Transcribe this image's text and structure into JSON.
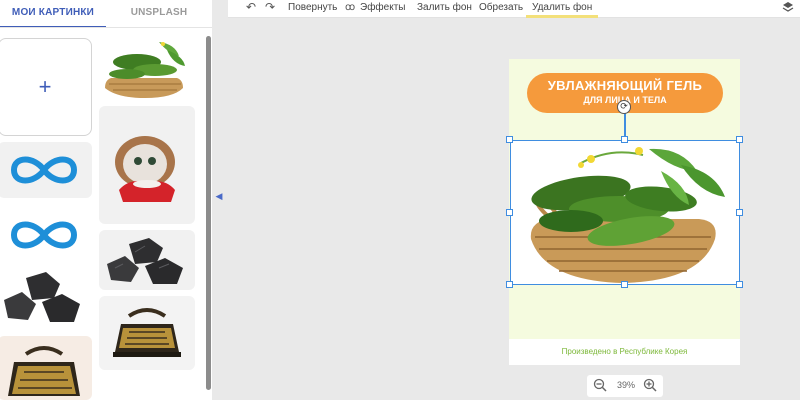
{
  "tabs": {
    "my_images": "МОИ КАРТИНКИ",
    "unsplash": "UNSPLASH"
  },
  "left_panel": {
    "add_label": "+",
    "thumbnails": [
      "cucumber-basket",
      "infinity-logo",
      "kitten-photo",
      "infinity-logo",
      "coal-stones",
      "coal-stones",
      "cast-iron-iron",
      "cast-iron-iron"
    ]
  },
  "toolbar": {
    "undo_icon": "↶",
    "redo_icon": "↷",
    "rotate": "Повернуть",
    "effects_icon": "ꝏ",
    "effects": "Эффекты",
    "fill_bg": "Залить фон",
    "crop": "Обрезать",
    "remove_bg": "Удалить фон",
    "layers_icon": "layers-icon"
  },
  "document": {
    "headline_line1": "УВЛАЖНЯЮЩИЙ ГЕЛЬ",
    "headline_line2": "ДЛЯ ЛИЦА И ТЕЛА",
    "footer": "Произведено в Республике Корея",
    "background_color": "#f5fbdf",
    "accent_color": "#f59a3c"
  },
  "zoom": {
    "value": "39%"
  },
  "colors": {
    "selection": "#3f8de0",
    "tab_active": "#3f5db8",
    "footer_text": "#7db83a"
  }
}
